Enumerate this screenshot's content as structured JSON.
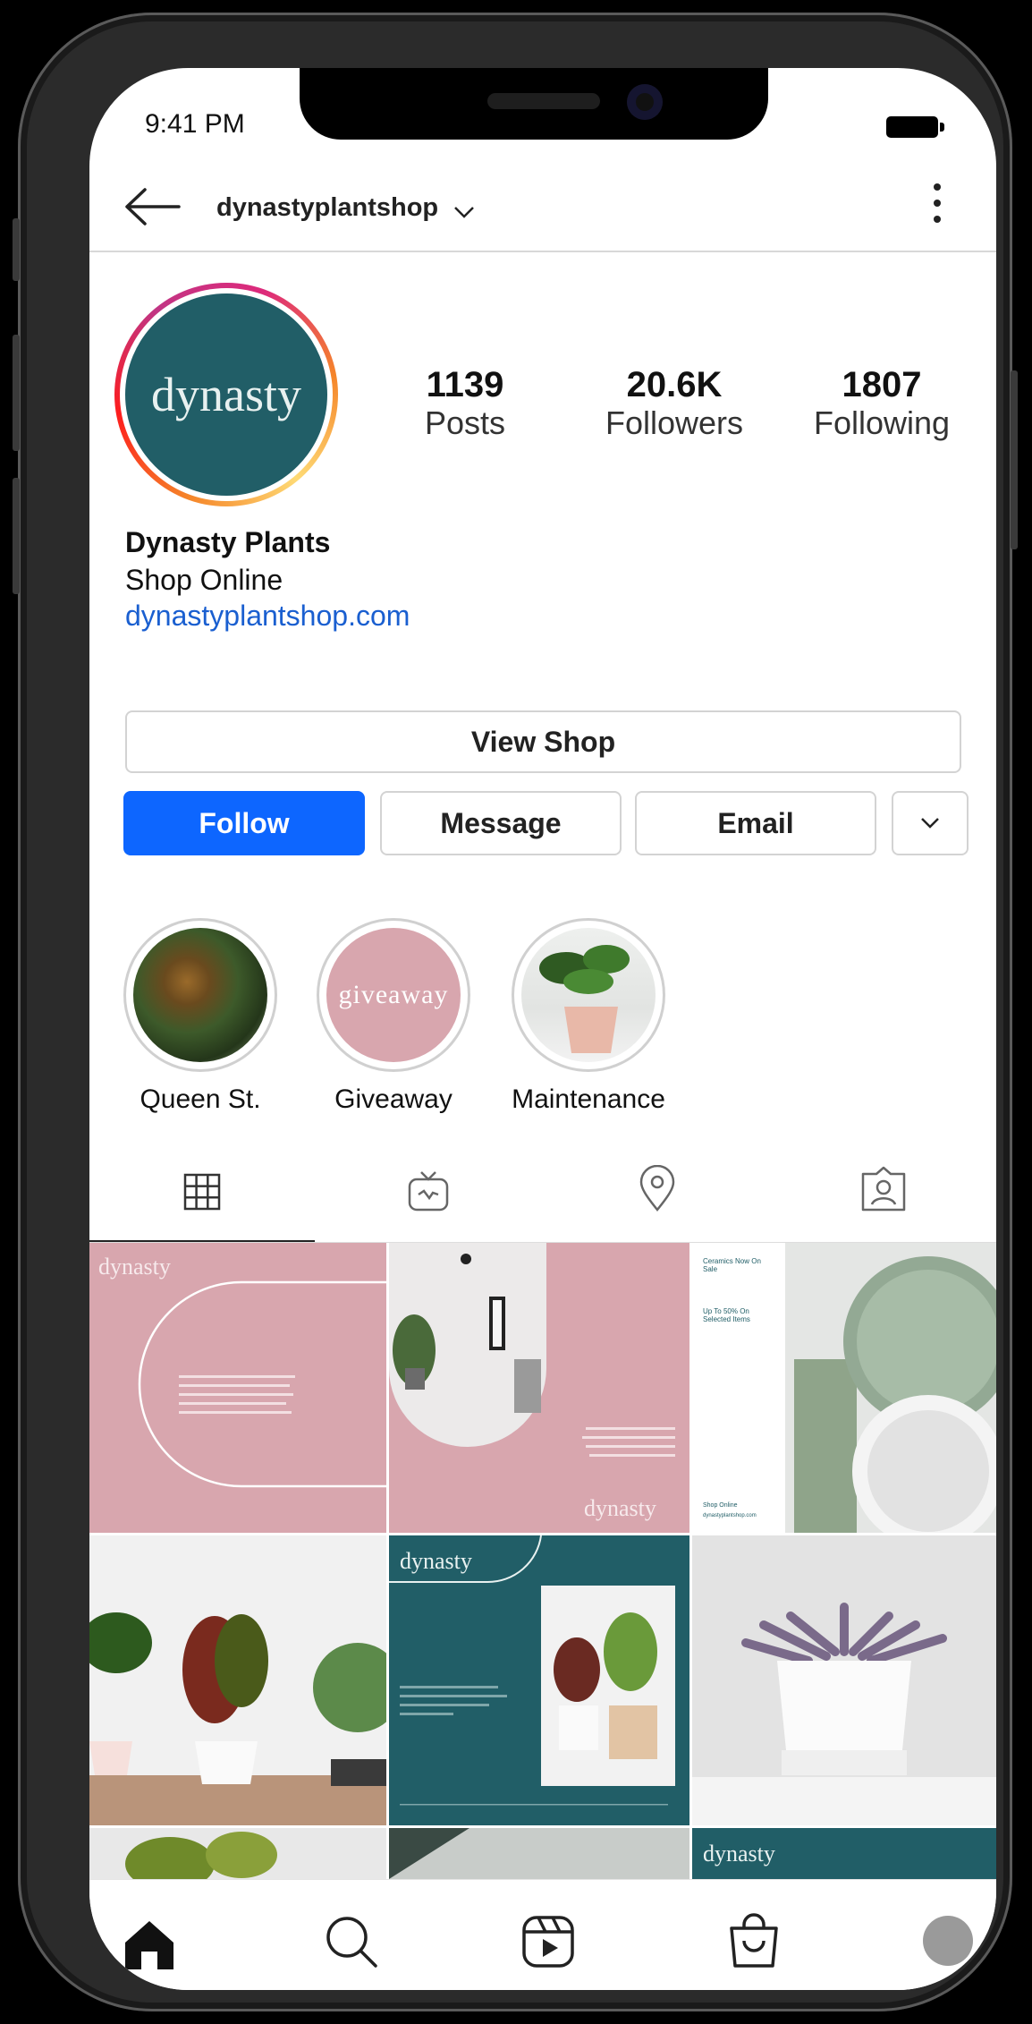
{
  "status": {
    "time": "9:41 PM"
  },
  "header": {
    "username": "dynastyplantshop"
  },
  "profile": {
    "avatar_text": "dynasty",
    "stats": [
      {
        "value": "1139",
        "label": "Posts"
      },
      {
        "value": "20.6K",
        "label": "Followers"
      },
      {
        "value": "1807",
        "label": "Following"
      }
    ],
    "name": "Dynasty Plants",
    "category": "Shop Online",
    "link": "dynastyplantshop.com"
  },
  "actions": {
    "view_shop": "View Shop",
    "follow": "Follow",
    "message": "Message",
    "email": "Email"
  },
  "highlights": [
    {
      "label": "Queen St."
    },
    {
      "label": "Giveaway",
      "cover_text": "giveaway"
    },
    {
      "label": "Maintenance"
    }
  ],
  "grid": {
    "logo": "dynasty",
    "tile3_texts": [
      "Ceramics Now On Sale",
      "Up To 50% On Selected Items",
      "Shop Online",
      "dynastyplantshop.com"
    ]
  },
  "colors": {
    "brand_teal": "#215e67",
    "brand_pink": "#d8a6ae",
    "follow_blue": "#0d66ff",
    "link_blue": "#1a5fd0"
  },
  "icons": [
    "back-arrow-icon",
    "chevron-down-icon",
    "more-options-icon",
    "grid-icon",
    "igtv-icon",
    "location-pin-icon",
    "tagged-icon",
    "home-icon",
    "search-icon",
    "reels-icon",
    "shop-bag-icon",
    "profile-icon"
  ]
}
